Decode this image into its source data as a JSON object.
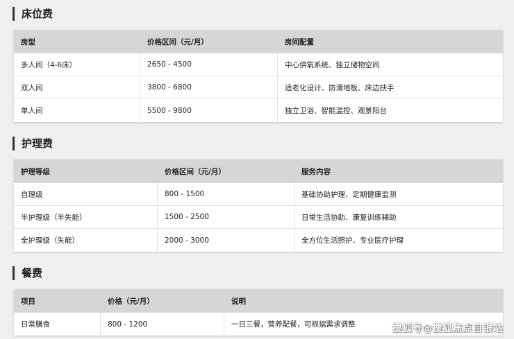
{
  "sections": [
    {
      "title": "床位费",
      "headers": [
        "房型",
        "价格区间（元/月）",
        "房间配置"
      ],
      "rows": [
        [
          "多人间（4-6床）",
          "2650 - 4500",
          "中心供氧系统、独立储物空间"
        ],
        [
          "双人间",
          "3800 - 6800",
          "适老化设计、防滑地板、床边扶手"
        ],
        [
          "单人间",
          "5500 - 9800",
          "独立卫浴、智能温控、观景阳台"
        ]
      ]
    },
    {
      "title": "护理费",
      "headers": [
        "护理等级",
        "价格区间（元/月）",
        "服务内容"
      ],
      "rows": [
        [
          "自理级",
          "800 - 1500",
          "基础协助护理、定期健康监测"
        ],
        [
          "半护理级（半失能）",
          "1500 - 2500",
          "日常生活协助、康复训练辅助"
        ],
        [
          "全护理级（失能）",
          "2000 - 3000",
          "全方位生活照护、专业医疗护理"
        ]
      ]
    },
    {
      "title": "餐费",
      "headers": [
        "项目",
        "价格（元/月）",
        "说明"
      ],
      "rows": [
        [
          "日常膳食",
          "800 - 1200",
          "一日三餐，营养配餐，可根据需求调整"
        ]
      ]
    }
  ],
  "watermark": "搜狐号@搜狐焦点自银站"
}
